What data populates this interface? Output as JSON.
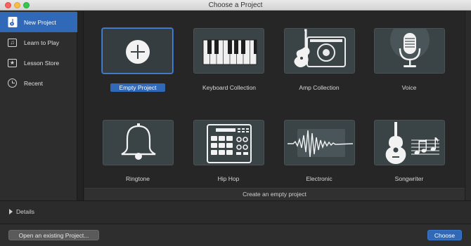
{
  "window": {
    "title": "Choose a Project"
  },
  "sidebar": {
    "items": [
      {
        "label": "New Project",
        "icon": "guitar-doc-icon",
        "active": true
      },
      {
        "label": "Learn to Play",
        "icon": "music-note-icon",
        "active": false
      },
      {
        "label": "Lesson Store",
        "icon": "star-icon",
        "active": false
      },
      {
        "label": "Recent",
        "icon": "clock-icon",
        "active": false
      }
    ]
  },
  "projects": [
    {
      "label": "Empty Project",
      "icon": "plus-icon",
      "selected": true
    },
    {
      "label": "Keyboard Collection",
      "icon": "keyboard-icon",
      "selected": false
    },
    {
      "label": "Amp Collection",
      "icon": "amp-guitar-icon",
      "selected": false
    },
    {
      "label": "Voice",
      "icon": "microphone-icon",
      "selected": false
    },
    {
      "label": "Ringtone",
      "icon": "bell-icon",
      "selected": false
    },
    {
      "label": "Hip Hop",
      "icon": "drum-machine-icon",
      "selected": false
    },
    {
      "label": "Electronic",
      "icon": "waveform-icon",
      "selected": false
    },
    {
      "label": "Songwriter",
      "icon": "acoustic-guitar-notes-icon",
      "selected": false
    }
  ],
  "status": {
    "text": "Create an empty project"
  },
  "details": {
    "label": "Details"
  },
  "buttons": {
    "open": "Open an existing Project...",
    "choose": "Choose"
  },
  "colors": {
    "accent": "#2f69b8",
    "tile_bg": "#3a4346",
    "background": "#262626"
  }
}
